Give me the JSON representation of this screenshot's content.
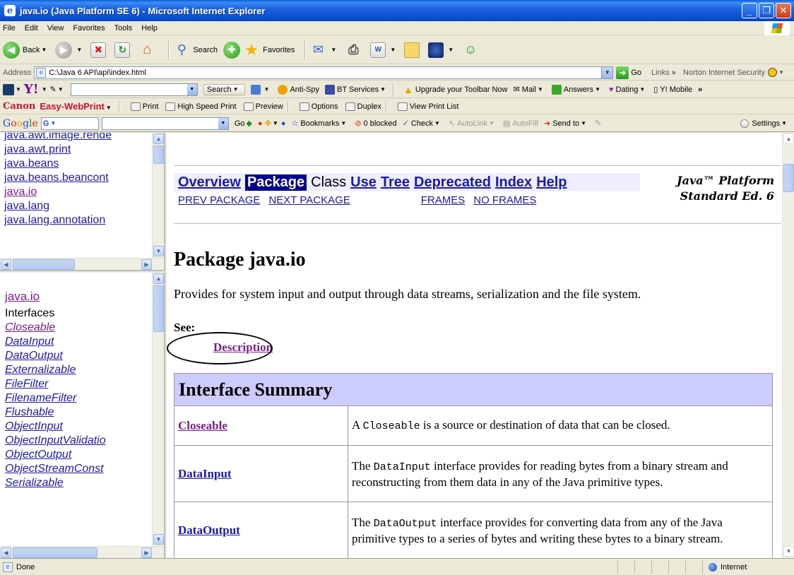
{
  "window": {
    "title": "java.io (Java Platform SE 6) - Microsoft Internet Explorer"
  },
  "menu": [
    "File",
    "Edit",
    "View",
    "Favorites",
    "Tools",
    "Help"
  ],
  "toolbar": {
    "back": "Back",
    "search": "Search",
    "favorites": "Favorites"
  },
  "address": {
    "label": "Address",
    "value": "C:\\Java 6 API\\api\\index.html",
    "go": "Go",
    "links": "Links",
    "norton": "Norton Internet Security"
  },
  "yahoo": {
    "search": "Search",
    "antispy": "Anti-Spy",
    "bt": "BT Services",
    "upgrade": "Upgrade your Toolbar Now",
    "mail": "Mail",
    "answers": "Answers",
    "dating": "Dating",
    "mobile": "Y! Mobile"
  },
  "canon": {
    "brand": "Canon",
    "product": "Easy-WebPrint",
    "print": "Print",
    "hsprint": "High Speed Print",
    "preview": "Preview",
    "options": "Options",
    "duplex": "Duplex",
    "viewlist": "View Print List"
  },
  "google": {
    "go": "Go",
    "bookmarks": "Bookmarks",
    "blocked": "0 blocked",
    "check": "Check",
    "autolink": "AutoLink",
    "autofill": "AutoFill",
    "sendto": "Send to",
    "settings": "Settings"
  },
  "packages": [
    "java.awt.image.rende",
    "java.awt.print",
    "java.beans",
    "java.beans.beancont",
    "java.io",
    "java.lang",
    "java.lang.annotation"
  ],
  "classframe": {
    "package": "java.io",
    "section": "Interfaces",
    "items": [
      "Closeable",
      "DataInput",
      "DataOutput",
      "Externalizable",
      "FileFilter",
      "FilenameFilter",
      "Flushable",
      "ObjectInput",
      "ObjectInputValidatio",
      "ObjectOutput",
      "ObjectStreamConst",
      "Serializable"
    ]
  },
  "doc": {
    "nav": {
      "overview": "Overview",
      "package": "Package",
      "class": "Class",
      "use": "Use",
      "tree": "Tree",
      "deprecated": "Deprecated",
      "index": "Index",
      "help": "Help"
    },
    "platform_line1": "Java™ Platform",
    "platform_line2": "Standard Ed. 6",
    "subnav": {
      "prev": "PREV PACKAGE",
      "next": "NEXT PACKAGE",
      "frames": "FRAMES",
      "noframes": "NO FRAMES"
    },
    "title": "Package java.io",
    "description": "Provides for system input and output through data streams, serialization and the file system.",
    "see": "See:",
    "desc_link": "Description",
    "summary_title": "Interface Summary",
    "rows": [
      {
        "name": "Closeable",
        "pre": "A ",
        "code": "Closeable",
        "post": " is a source or destination of data that can be closed."
      },
      {
        "name": "DataInput",
        "pre": "The ",
        "code": "DataInput",
        "post": " interface provides for reading bytes from a binary stream and reconstructing from them data in any of the Java primitive types."
      },
      {
        "name": "DataOutput",
        "pre": "The ",
        "code": "DataOutput",
        "post": " interface provides for converting data from any of the Java primitive types to a series of bytes and writing these bytes to a binary stream."
      }
    ]
  },
  "status": {
    "text": "Done",
    "zone": "Internet"
  }
}
